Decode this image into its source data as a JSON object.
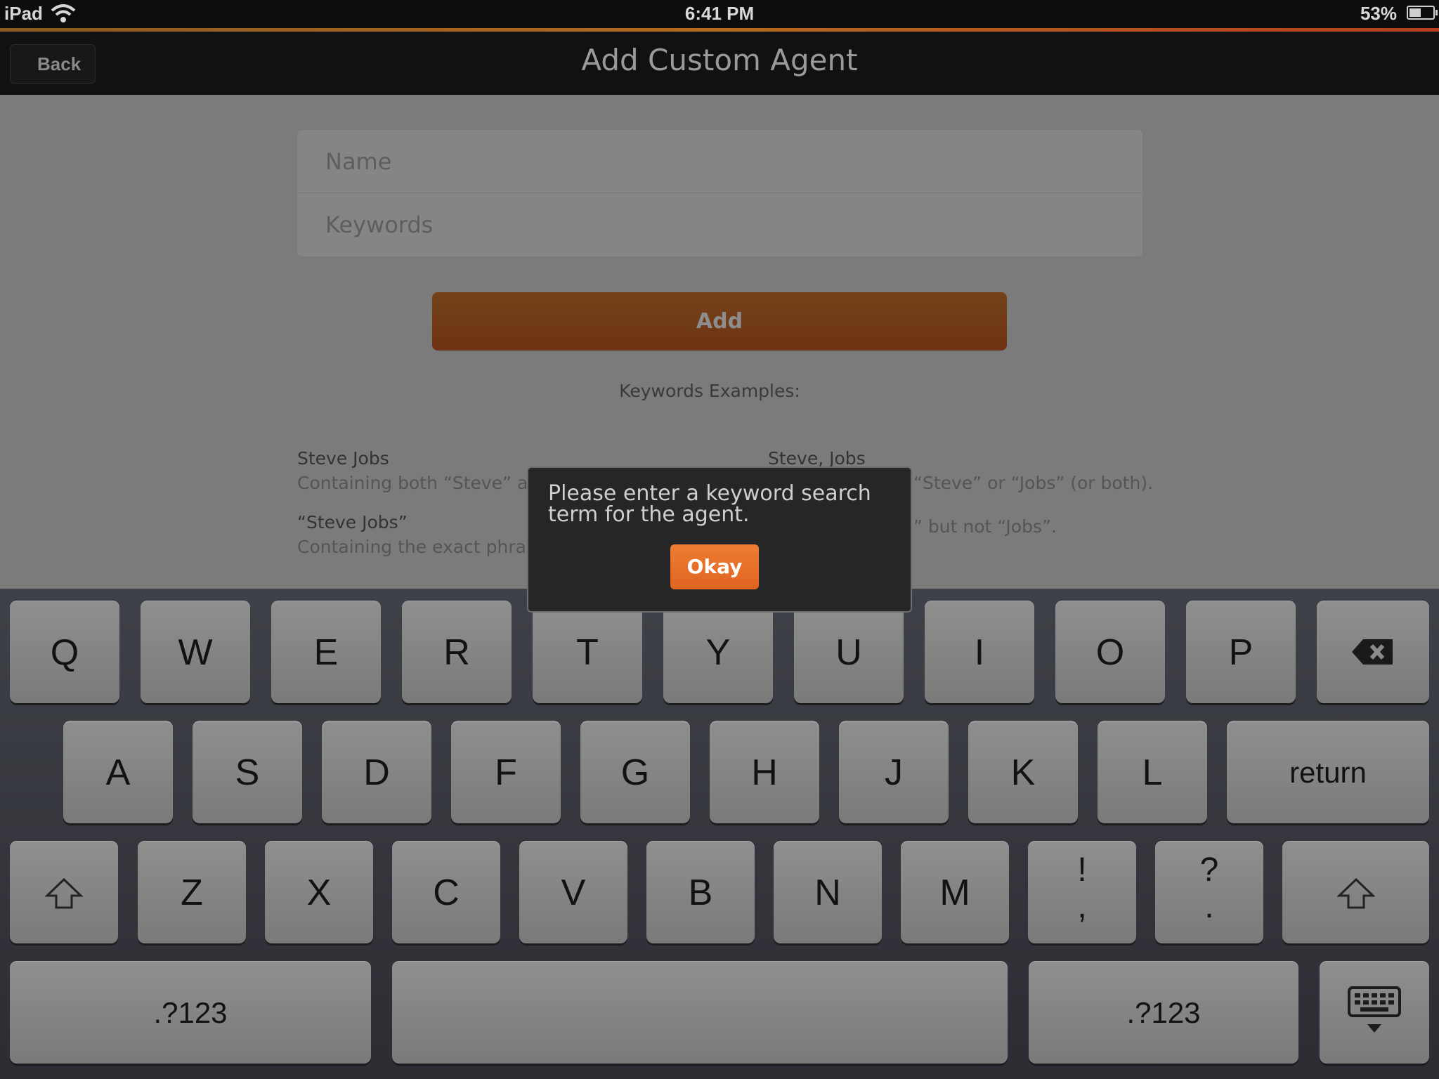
{
  "status_bar": {
    "device": "iPad",
    "time": "6:41 PM",
    "battery": "53%"
  },
  "nav": {
    "back_label": "Back",
    "title": "Add Custom Agent"
  },
  "form": {
    "name_placeholder": "Name",
    "keywords_placeholder": "Keywords",
    "add_label": "Add"
  },
  "examples": {
    "heading": "Keywords Examples:",
    "items": [
      {
        "title": "Steve Jobs",
        "desc": "Containing both “Steve” and"
      },
      {
        "title": "Steve, Jobs",
        "desc": "“Steve” or “Jobs” (or both)."
      },
      {
        "title": "“Steve Jobs”",
        "desc": "Containing the exact phrase"
      },
      {
        "title": "",
        "desc": "” but not “Jobs”."
      }
    ]
  },
  "dialog": {
    "message": "Please enter a keyword search term for the agent.",
    "ok_label": "Okay"
  },
  "keyboard": {
    "row1": [
      "Q",
      "W",
      "E",
      "R",
      "T",
      "Y",
      "U",
      "I",
      "O",
      "P"
    ],
    "row2": [
      "A",
      "S",
      "D",
      "F",
      "G",
      "H",
      "J",
      "K",
      "L"
    ],
    "row3": [
      "Z",
      "X",
      "C",
      "V",
      "B",
      "N",
      "M"
    ],
    "row3_punct": [
      {
        "top": "!",
        "bottom": ","
      },
      {
        "top": "?",
        "bottom": "."
      }
    ],
    "return_label": "return",
    "numbers_label": ".?123"
  },
  "colors": {
    "accent": "#e8712a",
    "add_button": "#723b16"
  }
}
